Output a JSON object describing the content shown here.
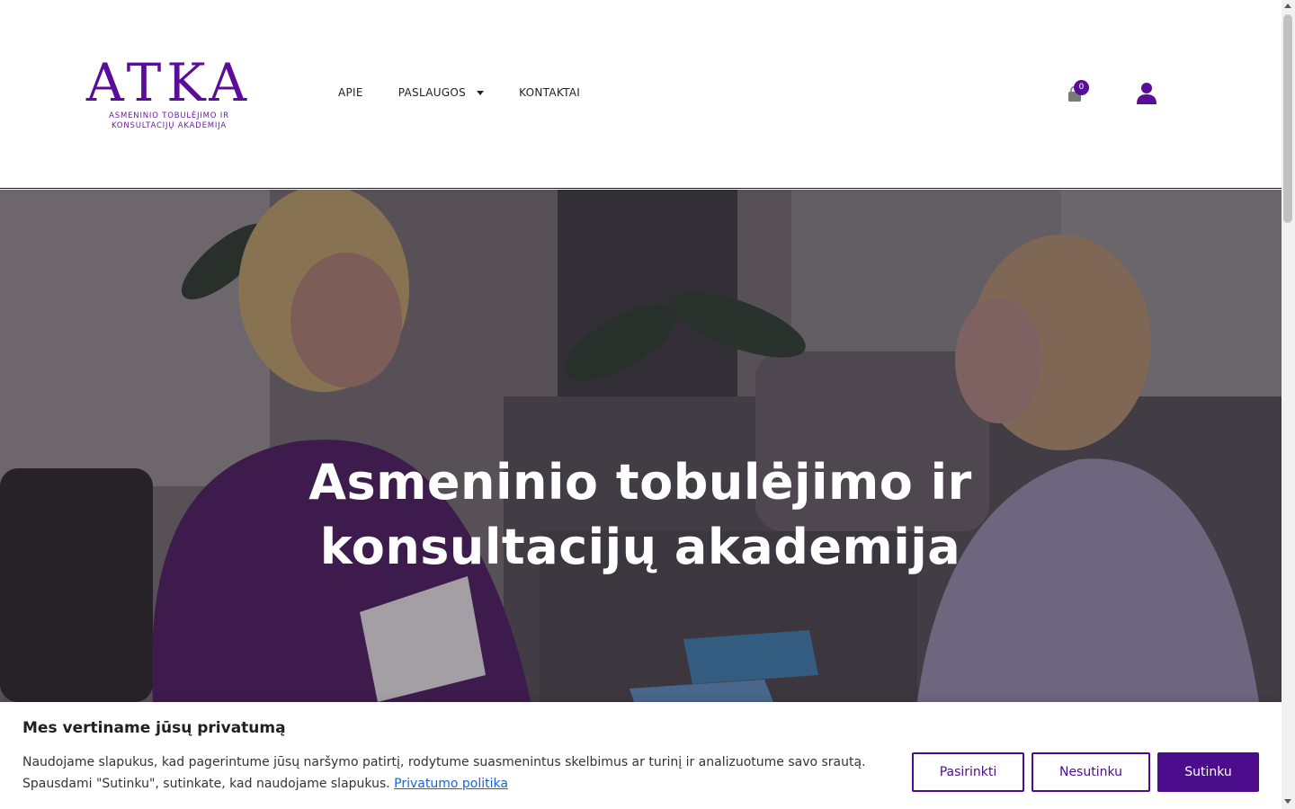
{
  "brand": {
    "logo_text": "ATKA",
    "logo_subtitle_line1": "ASMENINIO  TOBULĖJIMO IR",
    "logo_subtitle_line2": "KONSULTACIJŲ AKADEMIJA",
    "accent_color": "#5a0d99"
  },
  "nav": {
    "items": [
      {
        "label": "APIE"
      },
      {
        "label": "PASLAUGOS",
        "has_dropdown": true
      },
      {
        "label": "KONTAKTAI"
      }
    ]
  },
  "header_actions": {
    "cart_icon": "shopping-bag-icon",
    "cart_count": "0",
    "user_icon": "user-icon"
  },
  "hero": {
    "title_line1": "Asmeninio tobulėjimo ir",
    "title_line2": "konsultacijų akademija"
  },
  "cookie_banner": {
    "title": "Mes vertiname jūsų privatumą",
    "text_line1": "Naudojame slapukus, kad pagerintume jūsų naršymo patirtį, rodytume suasmenintus skelbimus ar turinį ir analizuotume savo srautą.",
    "text_line2": "Spausdami \"Sutinku\", sutinkate, kad naudojame slapukus.",
    "privacy_link": "Privatumo politika",
    "customize_label": "Pasirinkti",
    "reject_label": "Nesutinku",
    "accept_label": "Sutinku",
    "button_color": "#4b0d8c"
  }
}
